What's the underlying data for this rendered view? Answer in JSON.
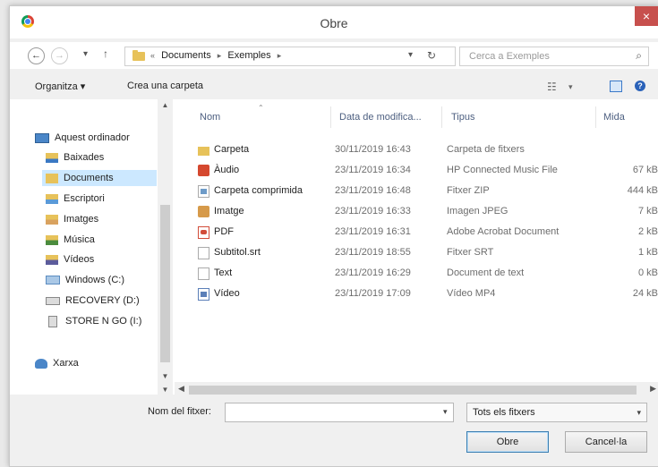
{
  "window": {
    "title": "Obre",
    "close_glyph": "×"
  },
  "navbar": {
    "breadcrumb_prefix": "«",
    "breadcrumbs": [
      "Documents",
      "Exemples"
    ],
    "search_placeholder": "Cerca a Exemples"
  },
  "toolbar": {
    "organize_label": "Organitza ▾",
    "new_folder_label": "Crea una carpeta"
  },
  "sidebar": {
    "items": [
      {
        "label": "Aquest ordinador",
        "icon": "computer-icon"
      },
      {
        "label": "Baixades",
        "icon": "downloads-folder-icon"
      },
      {
        "label": "Documents",
        "icon": "documents-folder-icon",
        "selected": true
      },
      {
        "label": "Escriptori",
        "icon": "desktop-folder-icon"
      },
      {
        "label": "Imatges",
        "icon": "pictures-folder-icon"
      },
      {
        "label": "Música",
        "icon": "music-folder-icon"
      },
      {
        "label": "Vídeos",
        "icon": "videos-folder-icon"
      },
      {
        "label": "Windows (C:)",
        "icon": "drive-icon"
      },
      {
        "label": "RECOVERY (D:)",
        "icon": "drive-icon"
      },
      {
        "label": "STORE N GO (I:)",
        "icon": "usb-drive-icon"
      },
      {
        "label": "Xarxa",
        "icon": "network-icon"
      }
    ]
  },
  "filelist": {
    "columns": {
      "name": "Nom",
      "date": "Data de modifica...",
      "type": "Tipus",
      "size": "Mida"
    },
    "rows": [
      {
        "name": "Carpeta",
        "date": "30/11/2019 16:43",
        "type": "Carpeta de fitxers",
        "size": "",
        "icon": "folder-icon"
      },
      {
        "name": "Àudio",
        "date": "23/11/2019 16:34",
        "type": "HP Connected Music File",
        "size": "67 kB",
        "icon": "audio-file-icon"
      },
      {
        "name": "Carpeta comprimida",
        "date": "23/11/2019 16:48",
        "type": "Fitxer ZIP",
        "size": "444 kB",
        "icon": "zip-file-icon"
      },
      {
        "name": "Imatge",
        "date": "23/11/2019 16:33",
        "type": "Imagen JPEG",
        "size": "7 kB",
        "icon": "image-file-icon"
      },
      {
        "name": "PDF",
        "date": "23/11/2019 16:31",
        "type": "Adobe Acrobat Document",
        "size": "2 kB",
        "icon": "pdf-file-icon"
      },
      {
        "name": "Subtitol.srt",
        "date": "23/11/2019 18:55",
        "type": "Fitxer SRT",
        "size": "1 kB",
        "icon": "text-file-icon"
      },
      {
        "name": "Text",
        "date": "23/11/2019 16:29",
        "type": "Document de text",
        "size": "0 kB",
        "icon": "text-file-icon"
      },
      {
        "name": "Vídeo",
        "date": "23/11/2019 17:09",
        "type": "Vídeo MP4",
        "size": "24 kB",
        "icon": "video-file-icon"
      }
    ]
  },
  "bottom": {
    "filename_label": "Nom del fitxer:",
    "filename_value": "",
    "filter_value": "Tots els fitxers",
    "open_label": "Obre",
    "cancel_label": "Cancel·la"
  }
}
